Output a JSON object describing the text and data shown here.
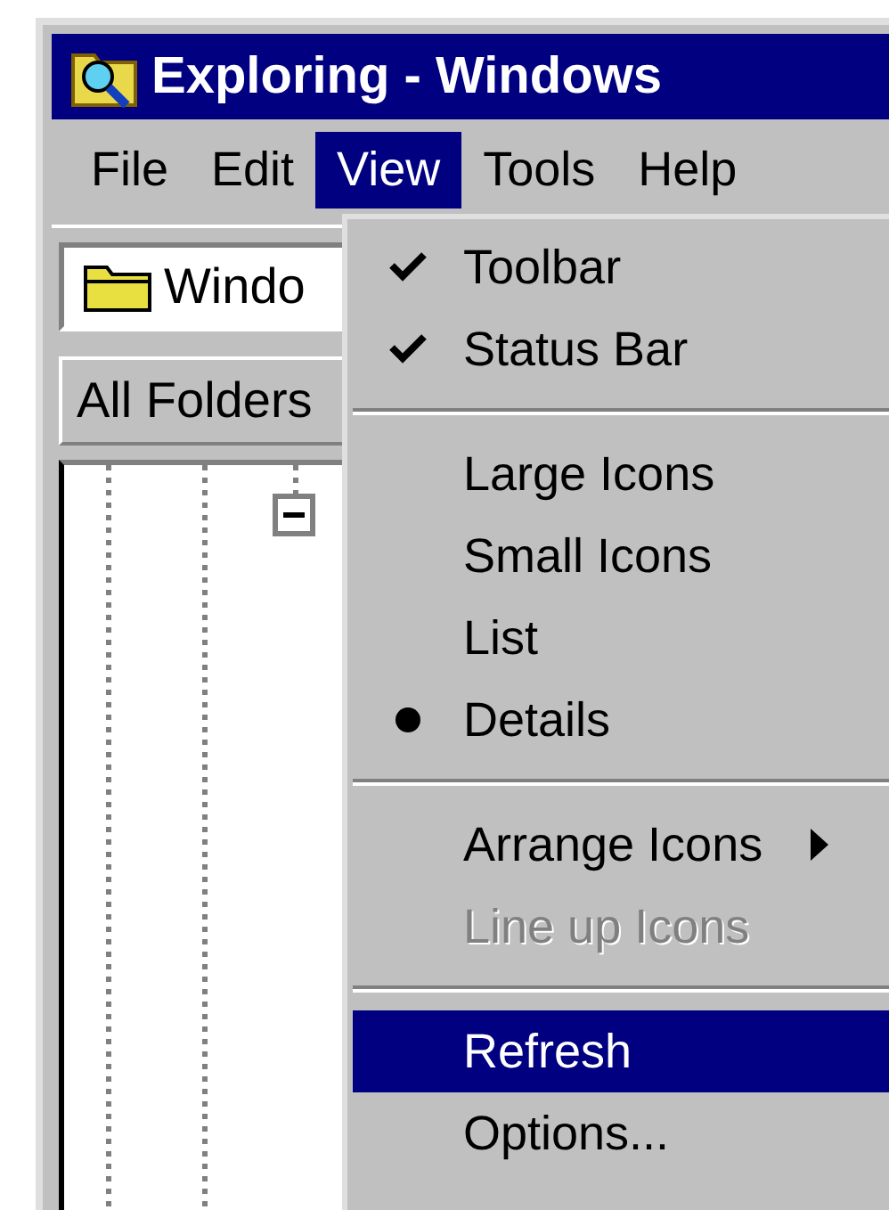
{
  "window": {
    "title": "Exploring - Windows"
  },
  "menubar": [
    {
      "label": "File",
      "selected": false
    },
    {
      "label": "Edit",
      "selected": false
    },
    {
      "label": "View",
      "selected": true
    },
    {
      "label": "Tools",
      "selected": false
    },
    {
      "label": "Help",
      "selected": false
    }
  ],
  "address": {
    "value": "Windo"
  },
  "tree_header": "All Folders",
  "view_menu": [
    {
      "kind": "item",
      "label": "Toolbar",
      "checked": true,
      "radio_checked": false,
      "disabled": false,
      "selected": false,
      "submenu": false
    },
    {
      "kind": "item",
      "label": "Status Bar",
      "checked": true,
      "radio_checked": false,
      "disabled": false,
      "selected": false,
      "submenu": false
    },
    {
      "kind": "separator"
    },
    {
      "kind": "item",
      "label": "Large Icons",
      "checked": false,
      "radio_checked": false,
      "disabled": false,
      "selected": false,
      "submenu": false
    },
    {
      "kind": "item",
      "label": "Small Icons",
      "checked": false,
      "radio_checked": false,
      "disabled": false,
      "selected": false,
      "submenu": false
    },
    {
      "kind": "item",
      "label": "List",
      "checked": false,
      "radio_checked": false,
      "disabled": false,
      "selected": false,
      "submenu": false
    },
    {
      "kind": "item",
      "label": "Details",
      "checked": false,
      "radio_checked": true,
      "disabled": false,
      "selected": false,
      "submenu": false
    },
    {
      "kind": "separator"
    },
    {
      "kind": "item",
      "label": "Arrange Icons",
      "checked": false,
      "radio_checked": false,
      "disabled": false,
      "selected": false,
      "submenu": true
    },
    {
      "kind": "item",
      "label": "Line up Icons",
      "checked": false,
      "radio_checked": false,
      "disabled": true,
      "selected": false,
      "submenu": false
    },
    {
      "kind": "separator"
    },
    {
      "kind": "item",
      "label": "Refresh",
      "checked": false,
      "radio_checked": false,
      "disabled": false,
      "selected": true,
      "submenu": false
    },
    {
      "kind": "item",
      "label": "Options...",
      "checked": false,
      "radio_checked": false,
      "disabled": false,
      "selected": false,
      "submenu": false
    }
  ]
}
